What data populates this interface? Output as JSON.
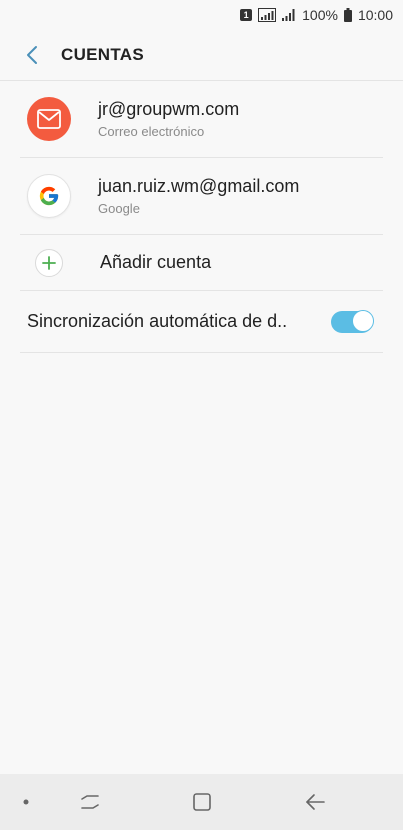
{
  "status_bar": {
    "sim_label": "1",
    "battery_percent": "100%",
    "time": "10:00"
  },
  "header": {
    "title": "CUENTAS",
    "back_icon": "back-arrow-icon"
  },
  "accounts": [
    {
      "primary": "jr@groupwm.com",
      "secondary": "Correo electrónico",
      "icon": "email-envelope-icon",
      "icon_color": "#f35b3f"
    },
    {
      "primary": "juan.ruiz.wm@gmail.com",
      "secondary": "Google",
      "icon": "google-logo-icon"
    }
  ],
  "add_account": {
    "label": "Añadir cuenta",
    "icon": "plus-icon",
    "icon_color": "#4caf50"
  },
  "auto_sync": {
    "label": "Sincronización automática de d..",
    "enabled": true,
    "accent": "#5bbde4"
  },
  "nav_bar": {
    "buttons": [
      "dot-icon",
      "recent-apps-icon",
      "home-icon",
      "back-icon"
    ]
  }
}
